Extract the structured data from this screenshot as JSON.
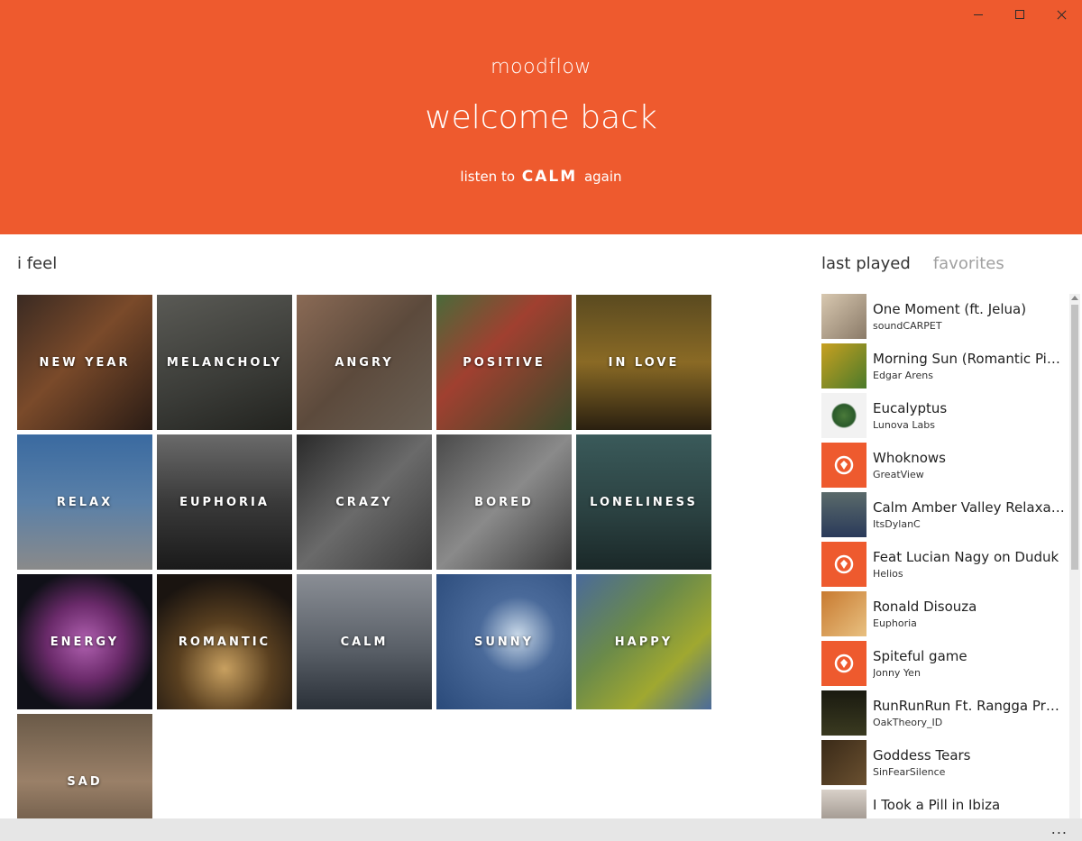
{
  "header": {
    "app_name": "moodflow",
    "welcome": "welcome back",
    "listen_prefix": "listen to",
    "listen_mood": "CALM",
    "listen_suffix": "again",
    "accent_color": "#ee5a2e"
  },
  "feel": {
    "title": "i feel",
    "moods": [
      {
        "label": "NEW YEAR"
      },
      {
        "label": "MELANCHOLY"
      },
      {
        "label": "ANGRY"
      },
      {
        "label": "POSITIVE"
      },
      {
        "label": "IN LOVE"
      },
      {
        "label": "RELAX"
      },
      {
        "label": "EUPHORIA"
      },
      {
        "label": "CRAZY"
      },
      {
        "label": "BORED"
      },
      {
        "label": "LONELINESS"
      },
      {
        "label": "ENERGY"
      },
      {
        "label": "ROMANTIC"
      },
      {
        "label": "CALM"
      },
      {
        "label": "SUNNY"
      },
      {
        "label": "HAPPY"
      },
      {
        "label": "SAD"
      }
    ]
  },
  "side": {
    "tabs": [
      "last played",
      "favorites"
    ],
    "tracks": [
      {
        "title": "One Moment (ft. Jelua)",
        "artist": "soundCARPET"
      },
      {
        "title": "Morning Sun (Romantic Piano...",
        "artist": "Edgar Arens"
      },
      {
        "title": "Eucalyptus",
        "artist": "Lunova Labs"
      },
      {
        "title": "Whoknows",
        "artist": "GreatView"
      },
      {
        "title": "Calm Amber Valley Relaxation...",
        "artist": "ItsDylanC"
      },
      {
        "title": "Feat Lucian Nagy on Duduk",
        "artist": "Helios"
      },
      {
        "title": "Ronald Disouza",
        "artist": "Euphoria"
      },
      {
        "title": "Spiteful game",
        "artist": "Jonny Yen"
      },
      {
        "title": "RunRunRun Ft.  Rangga Pran...",
        "artist": "OakTheory_ID"
      },
      {
        "title": "Goddess Tears",
        "artist": "SinFearSilence"
      },
      {
        "title": "I Took a Pill in Ibiza",
        "artist": ""
      }
    ]
  },
  "appbar": {
    "more": "..."
  }
}
